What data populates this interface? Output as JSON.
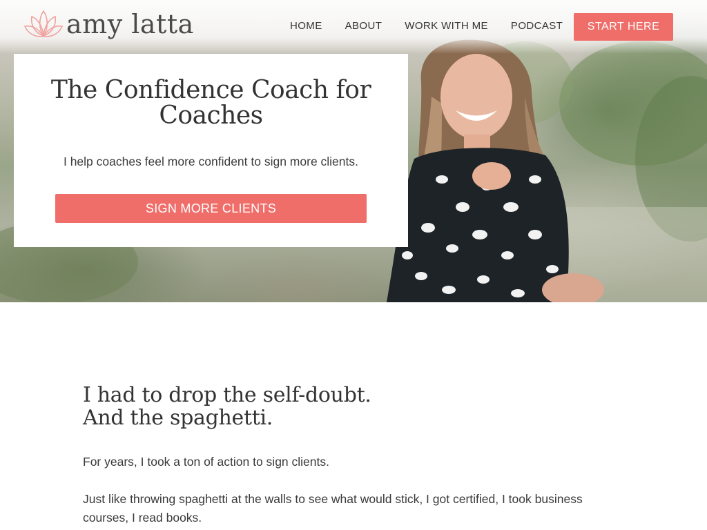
{
  "header": {
    "logo_text": "amy latta",
    "nav": [
      "HOME",
      "ABOUT",
      "WORK WITH ME",
      "PODCAST"
    ],
    "cta_label": "START HERE"
  },
  "hero": {
    "title": "The Confidence Coach for Coaches",
    "subtitle": "I help coaches feel more confident to sign more clients.",
    "button_label": "SIGN MORE CLIENTS"
  },
  "story": {
    "title_line1": "I had to drop the self-doubt.",
    "title_line2": "And the spaghetti.",
    "paragraphs": [
      "For years, I took a ton of action to sign clients.",
      "Just like throwing spaghetti at the walls to see what would stick, I got certified, I took business courses, I read books."
    ]
  },
  "colors": {
    "accent": "#ef6e6a",
    "logo_mark": "#f0a3a0",
    "text": "#333333"
  },
  "icons": {
    "logo": "lotus-icon"
  }
}
